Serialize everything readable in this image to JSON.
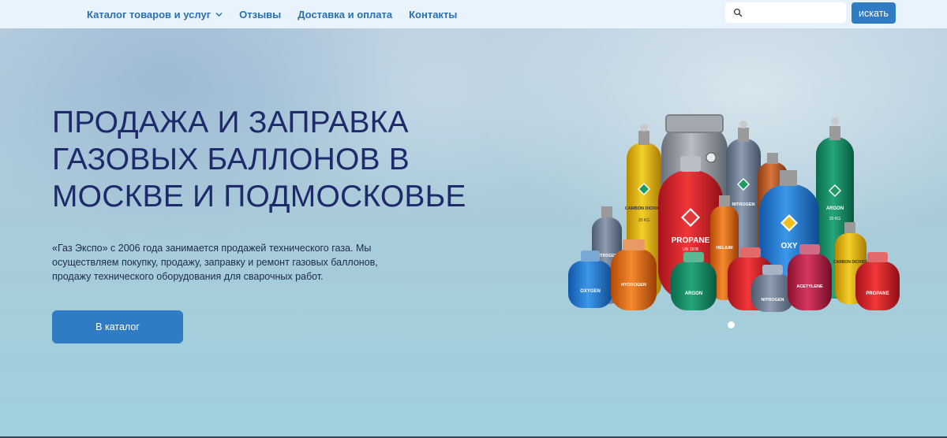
{
  "nav": {
    "items": [
      {
        "label": "Каталог товаров и услуг",
        "has_dropdown": true
      },
      {
        "label": "Отзывы"
      },
      {
        "label": "Доставка и оплата"
      },
      {
        "label": "Контакты"
      }
    ],
    "search": {
      "placeholder": "",
      "value": "",
      "button_label": "искать",
      "icon": "search-icon"
    }
  },
  "hero": {
    "title_lines": [
      "ПРОДАЖА И ЗАПРАВКА",
      "ГАЗОВЫХ БАЛЛОНОВ В",
      "МОСКВЕ И ПОДМОСКОВЬЕ"
    ],
    "text_lines": [
      "«Газ Экспо» с 2006 года занимается продажей технического газа. Мы",
      "осуществляем покупку, продажу, заправку и ремонт газовых баллонов,",
      "продажу технического оборудования для сварочных работ."
    ],
    "button_label": "В каталог",
    "slider": {
      "total": 1,
      "active": 1
    }
  },
  "cylinder_labels": {
    "co2": "CARBON DIOXIDE",
    "co2_weight": "20 KG",
    "nitrogen": "NITROGEN",
    "argon": "ARGON",
    "argon_weight": "20 KG",
    "propane": "PROPANE",
    "propane_un": "UN 1978",
    "helium": "HELIUM",
    "oxy": "OXY",
    "nitrogen2": "NITROGEN",
    "hydrogen": "HYDROGEN",
    "oxygen": "OXYGEN",
    "argon2": "ARGON",
    "nitrogen3": "NITROGEN",
    "acetylene": "ACETYLENE",
    "propane2": "PROPANE",
    "co2_2": "CARBON DIOXIDE"
  },
  "colors": {
    "nav_bg": "#e8f3fd",
    "nav_link": "#2a6fae",
    "button": "#2f7cc4",
    "title": "#1f2a6b"
  }
}
